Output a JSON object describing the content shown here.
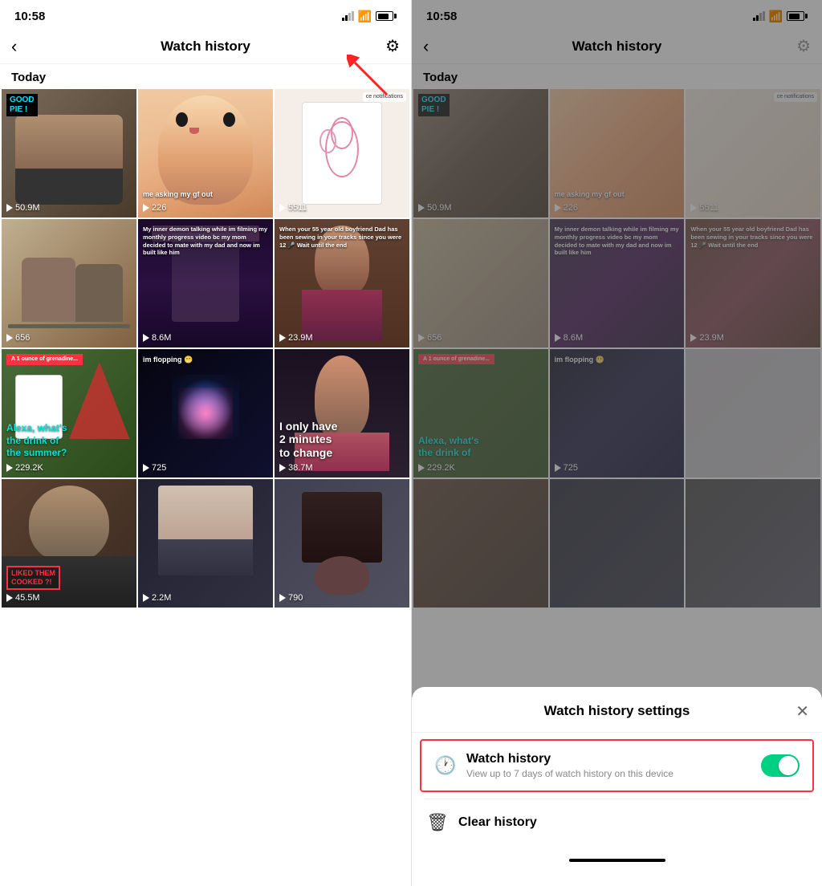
{
  "left_panel": {
    "status": {
      "time": "10:58"
    },
    "nav": {
      "back_label": "‹",
      "title": "Watch history",
      "gear_label": "⚙"
    },
    "section": "Today",
    "videos": [
      {
        "id": 1,
        "count": "50.9M",
        "label": "GOOD\nPIE !",
        "has_label": true,
        "color_class": "vt-1"
      },
      {
        "id": 2,
        "count": "226",
        "overlay": "me asking my gf out",
        "color_class": "vt-2"
      },
      {
        "id": 3,
        "count": "5511",
        "has_notif": true,
        "color_class": "vt-3"
      },
      {
        "id": 4,
        "count": "656",
        "color_class": "vt-4"
      },
      {
        "id": 5,
        "count": "8.6M",
        "overlay": "My inner demon talking while im filming my monthly progress video bc my mom decided to mate with my dad and now im built like him",
        "color_class": "vt-5"
      },
      {
        "id": 6,
        "count": "23.9M",
        "overlay": "When your 55 year old boyfriend Dad has been sewing in your tracks since you were 12 🎤 Wait until the end",
        "color_class": "vt-6"
      },
      {
        "id": 7,
        "count": "229.2K",
        "teal_text": "Alexa, what's the drink of the summer?",
        "red_badge": "A 1 ounce of grenadine...",
        "color_class": "vt-7"
      },
      {
        "id": 8,
        "count": "725",
        "overlay": "im flopping 😬",
        "color_class": "vt-8"
      },
      {
        "id": 9,
        "count": "38.7M",
        "big_text": "I only have\n2 minutes\nto change",
        "color_class": "vt-9"
      },
      {
        "id": 10,
        "count": "45.5M",
        "liked_badge": "LIKED THEM\nCOOKED ?!",
        "color_class": "vt-10"
      },
      {
        "id": 11,
        "count": "2.2M",
        "color_class": "vt-11"
      },
      {
        "id": 12,
        "count": "790",
        "color_class": "vt-12"
      }
    ]
  },
  "right_panel": {
    "status": {
      "time": "10:58"
    },
    "nav": {
      "back_label": "‹",
      "title": "Watch history",
      "gear_label": "⚙"
    },
    "section": "Today",
    "sheet": {
      "title": "Watch history settings",
      "close_label": "✕",
      "watch_history": {
        "icon": "🕐",
        "label": "Watch history",
        "sublabel": "View up to 7 days of watch history on this device",
        "toggle_on": true
      },
      "clear_history": {
        "icon": "🗑",
        "label": "Clear history"
      }
    },
    "home_indicator": true
  },
  "arrow": {
    "visible": true
  }
}
